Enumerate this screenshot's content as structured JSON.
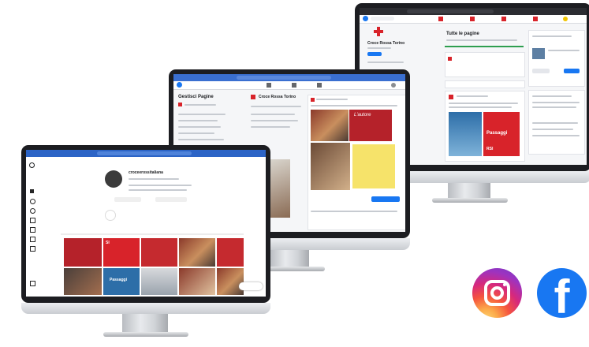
{
  "scene": {
    "brand_colors": {
      "instagram": "#d6287d",
      "facebook": "#1877f2",
      "red_cross": "#d8232a"
    }
  },
  "monitor_instagram": {
    "profile_name": "croceerossitaliana",
    "gallery_labels": [
      "SI",
      "Passaggi"
    ]
  },
  "monitor_facebook_pages": {
    "sidebar_title": "Gestisci Pagine",
    "page_name": "Croce Rossa Torino",
    "post_overlay": "L'autore"
  },
  "monitor_facebook_feed": {
    "header": "Tutte le pagine",
    "page_name": "Croce Rossa Torino",
    "card_title": "Passaggi",
    "card_badge": "RSI"
  },
  "logos": {
    "instagram": "instagram-icon",
    "facebook": "facebook-icon",
    "facebook_letter": "f"
  }
}
